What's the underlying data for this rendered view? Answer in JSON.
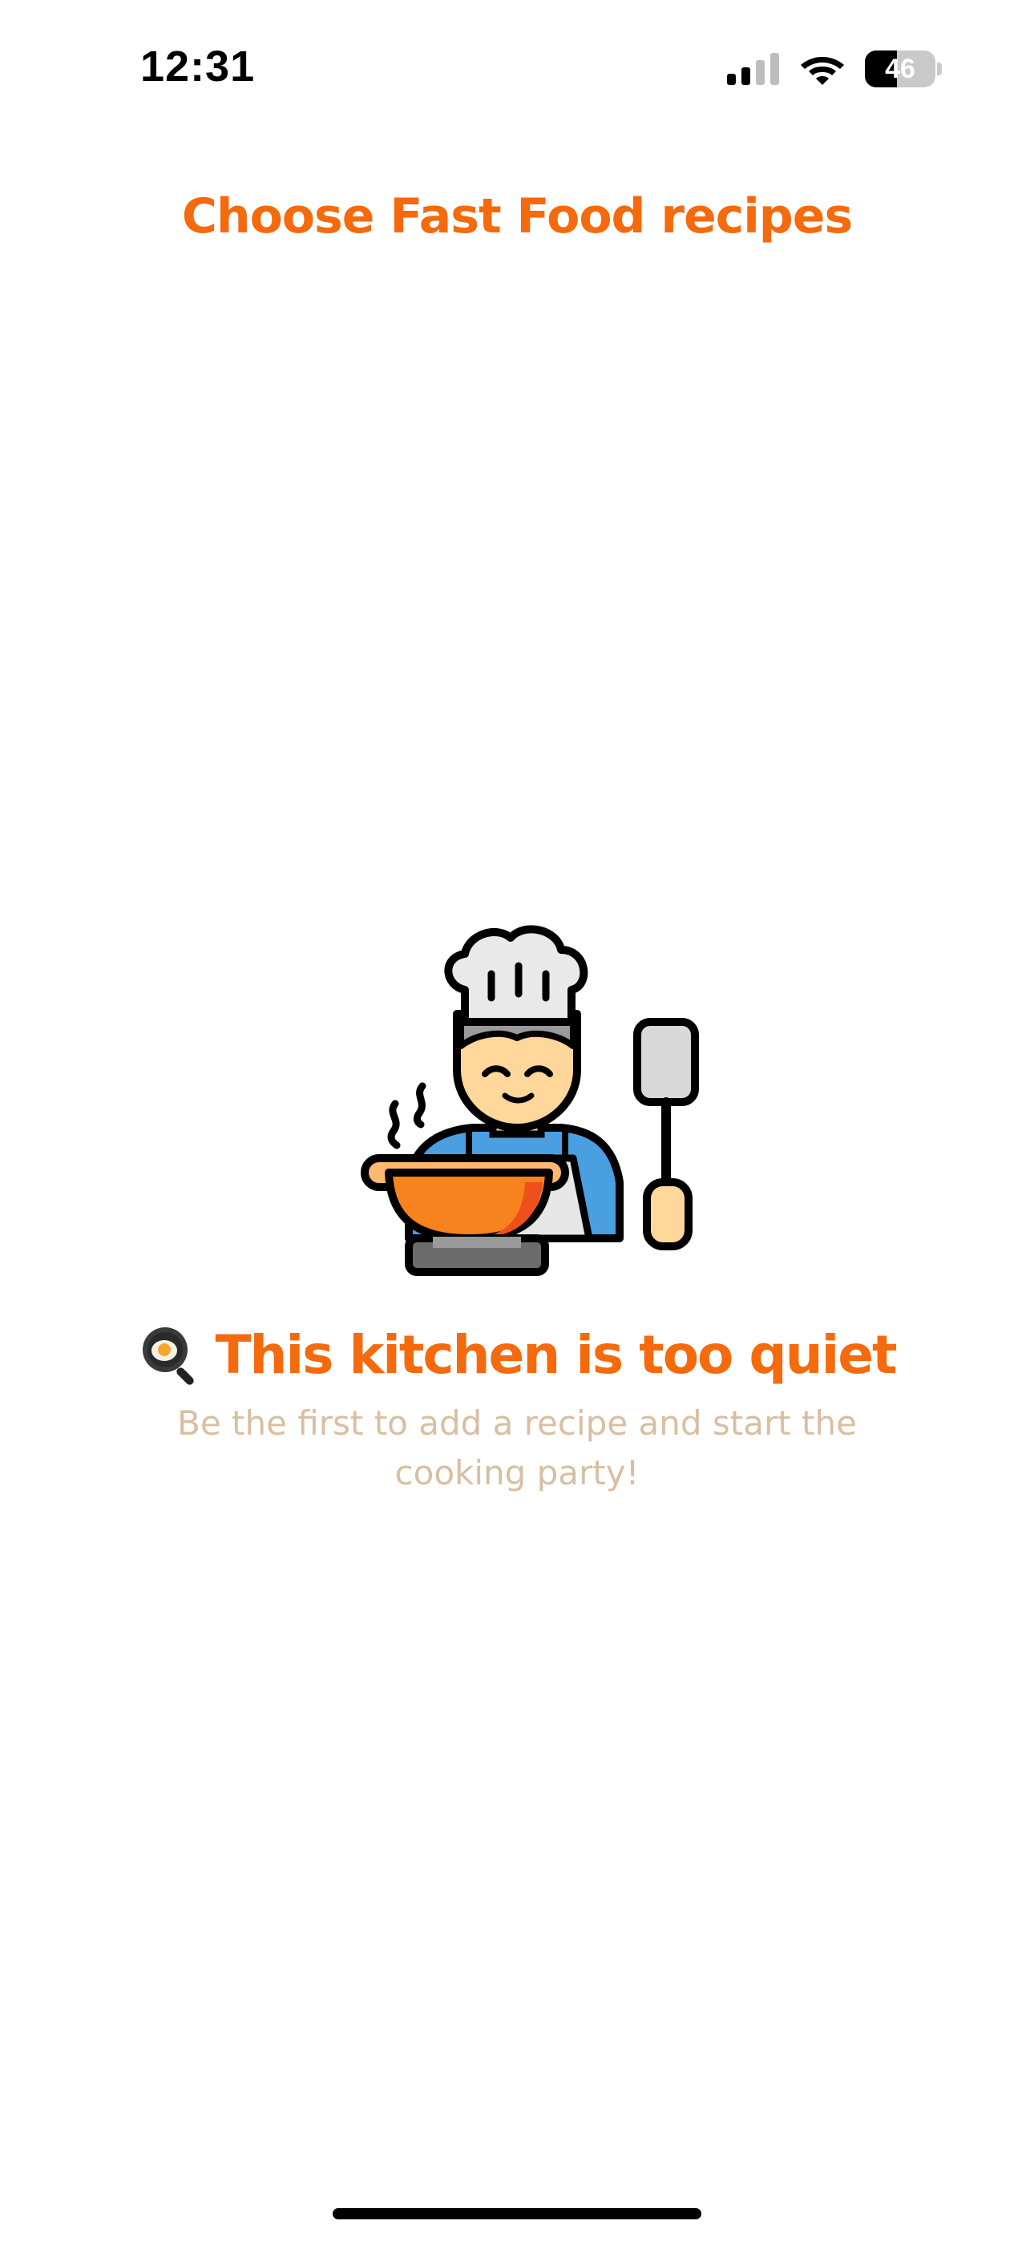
{
  "status_bar": {
    "time": "12:31",
    "battery_level": "46",
    "battery_fraction": 0.46,
    "signal_icon": "cellular-signal-icon",
    "wifi_icon": "wifi-icon"
  },
  "header": {
    "title": "Choose Fast Food recipes"
  },
  "empty_state": {
    "illustration_icon": "chef-cooking-icon",
    "emoji_icon": "frying-pan-egg-icon",
    "title": "This kitchen is too quiet",
    "subtitle": "Be the first to add a recipe and start the cooking party!"
  },
  "colors": {
    "accent": "#f46a0c",
    "subtitle": "#d8bfa2",
    "background": "#ffffff"
  }
}
